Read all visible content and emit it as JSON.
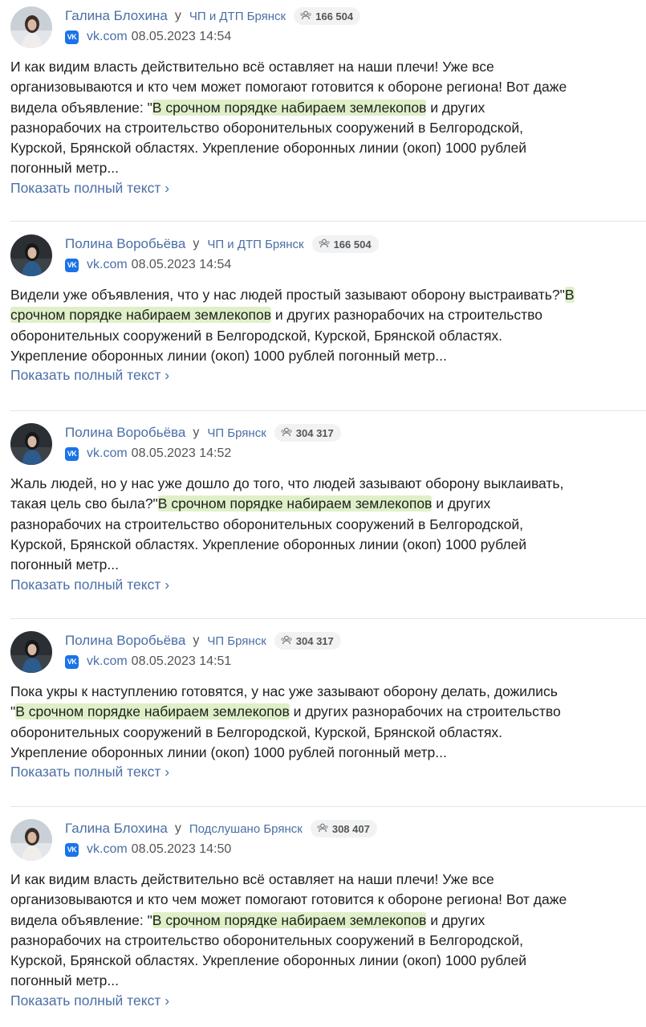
{
  "posts": [
    {
      "author": "Галина Блохина",
      "in_word": "у",
      "group": "ЧП и ДТП Брянск",
      "subscribers": "166 504",
      "avatar_icon": "avatar-woman-light-icon",
      "source": "vk.com",
      "datetime": "08.05.2023 14:54",
      "lines": [
        {
          "text": "И как видим власть действительно всё оставляет на наши плечи! Уже все"
        },
        {
          "text": "организовываются и кто чем может помогают готовится к обороне региона! Вот даже"
        },
        {
          "pre": "видела объявление: \"",
          "hl": "В срочном порядке набираем землекопов",
          "post": " и других"
        },
        {
          "text": "разнорабочих на строительство оборонительных сооружений в Белгородской,"
        },
        {
          "text": "Курской, Брянской областях. Укрепление оборонных линии (окоп) 1000 рублей"
        },
        {
          "text": "погонный метр..."
        }
      ],
      "more": "Показать полный текст ›"
    },
    {
      "author": "Полина Воробьёва",
      "in_word": "у",
      "group": "ЧП и ДТП Брянск",
      "subscribers": "166 504",
      "avatar_icon": "avatar-woman-dark-icon",
      "source": "vk.com",
      "datetime": "08.05.2023 14:54",
      "lines": [
        {
          "pre": "Видели уже объявления, что у нас людей простый зазывают оборону выстраивать?\"",
          "hl": "В",
          "post": ""
        },
        {
          "pre": "",
          "hl": "срочном порядке набираем землекопов",
          "post": " и других разнорабочих на строительство"
        },
        {
          "text": "оборонительных сооружений в Белгородской, Курской, Брянской областях."
        },
        {
          "text": "Укрепление оборонных линии (окоп) 1000 рублей погонный метр..."
        }
      ],
      "more": "Показать полный текст ›"
    },
    {
      "author": "Полина Воробьёва",
      "in_word": "у",
      "group": "ЧП Брянск",
      "subscribers": "304 317",
      "avatar_icon": "avatar-woman-dark-icon",
      "source": "vk.com",
      "datetime": "08.05.2023 14:52",
      "lines": [
        {
          "text": "Жаль людей, но у нас уже дошло до того, что людей зазывают оборону выклаивать,"
        },
        {
          "pre": "такая цель сво была?\"",
          "hl": "В срочном порядке набираем землекопов",
          "post": " и других"
        },
        {
          "text": "разнорабочих на строительство оборонительных сооружений в Белгородской,"
        },
        {
          "text": "Курской, Брянской областях. Укрепление оборонных линии (окоп) 1000 рублей"
        },
        {
          "text": "погонный метр..."
        }
      ],
      "more": "Показать полный текст ›"
    },
    {
      "author": "Полина Воробьёва",
      "in_word": "у",
      "group": "ЧП Брянск",
      "subscribers": "304 317",
      "avatar_icon": "avatar-woman-dark-icon",
      "source": "vk.com",
      "datetime": "08.05.2023 14:51",
      "lines": [
        {
          "text": "Пока укры к наступлению готовятся, у нас уже зазывают оборону делать, дожились"
        },
        {
          "pre": "\"",
          "hl": "В срочном порядке набираем землекопов",
          "post": " и других разнорабочих на строительство"
        },
        {
          "text": "оборонительных сооружений в Белгородской, Курской, Брянской областях."
        },
        {
          "text": "Укрепление оборонных линии (окоп) 1000 рублей погонный метр..."
        }
      ],
      "more": "Показать полный текст ›"
    },
    {
      "author": "Галина Блохина",
      "in_word": "у",
      "group": "Подслушано Брянск",
      "subscribers": "308 407",
      "avatar_icon": "avatar-woman-light-icon",
      "source": "vk.com",
      "datetime": "08.05.2023 14:50",
      "lines": [
        {
          "text": "И как видим власть действительно всё оставляет на наши плечи! Уже все"
        },
        {
          "text": "организовываются и кто чем может помогают готовится к обороне региона! Вот даже"
        },
        {
          "pre": "видела объявление: \"",
          "hl": "В срочном порядке набираем землекопов",
          "post": " и других"
        },
        {
          "text": "разнорабочих на строительство оборонительных сооружений в Белгородской,"
        },
        {
          "text": "Курской, Брянской областях. Укрепление оборонных линии (окоп) 1000 рублей"
        },
        {
          "text": "погонный метр..."
        }
      ],
      "more": "Показать полный текст ›"
    }
  ],
  "colors": {
    "link": "#4a6fa5",
    "highlight": "#dff0c8",
    "vk_brand": "#1a73e8",
    "badge_bg": "#f1f2f4"
  },
  "icons": {
    "vk_logo_text": "VK",
    "subscribers_icon": "people-icon"
  }
}
